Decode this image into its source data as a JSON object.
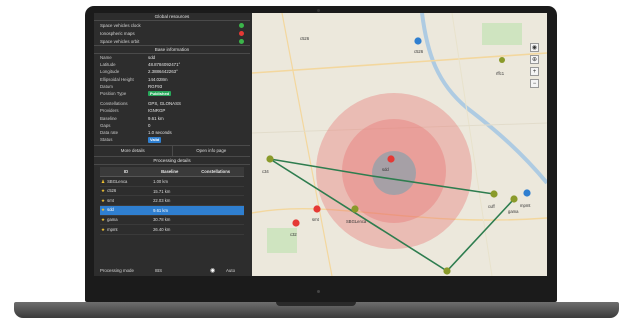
{
  "global_resources": {
    "title": "Global resources",
    "items": [
      {
        "label": "Space vehicles clock",
        "status_color": "#3bb54a"
      },
      {
        "label": "Ionospheric maps",
        "status_color": "#e53935"
      },
      {
        "label": "Space vehicles orbit",
        "status_color": "#3bb54a"
      }
    ]
  },
  "base_information": {
    "title": "Base information",
    "fields": [
      {
        "key": "Name",
        "value": "sdd"
      },
      {
        "key": "Latitude",
        "value": "48.8784092471°"
      },
      {
        "key": "Longitude",
        "value": "2.3886442263°"
      },
      {
        "key": "Ellipsoidal Height",
        "value": "144.028m"
      },
      {
        "key": "Datum",
        "value": "RGF93"
      }
    ],
    "position_type": {
      "key": "Position Type",
      "value": "Published",
      "color": "#27a85a"
    },
    "fields2": [
      {
        "key": "Constellations",
        "value": "GPS, GLONASS"
      },
      {
        "key": "Providers",
        "value": "IGNRGP"
      },
      {
        "key": "Baseline",
        "value": "9.61 km"
      },
      {
        "key": "Gaps",
        "value": "0"
      },
      {
        "key": "Data rate",
        "value": "1.0 seconds"
      }
    ],
    "status": {
      "key": "Status",
      "value": "Valid",
      "color": "#2f7fd0"
    }
  },
  "buttons": {
    "more_details": "More details",
    "open_info": "Open info page"
  },
  "processing": {
    "title": "Processing details",
    "headers": [
      "ID",
      "Baseline",
      "Constellations"
    ],
    "rows": [
      {
        "icon": "person",
        "id": "SBGLenca",
        "baseline": "1.00 km",
        "constellations": ""
      },
      {
        "icon": "star",
        "id": "c526",
        "baseline": "15.71 km",
        "constellations": ""
      },
      {
        "icon": "star",
        "id": "smt",
        "baseline": "22.03 km",
        "constellations": ""
      },
      {
        "icon": "star",
        "id": "sdd",
        "baseline": "9.61 km",
        "constellations": "",
        "selected": true
      },
      {
        "icon": "star",
        "id": "gama",
        "baseline": "30.78 km",
        "constellations": ""
      },
      {
        "icon": "star",
        "id": "mpmt",
        "baseline": "26.40 km",
        "constellations": ""
      }
    ],
    "footer": {
      "mode_label": "Processing mode",
      "mode_value": "IBS",
      "auto": "Auto"
    }
  },
  "map": {
    "labels": [
      "c526",
      "c526",
      "sdd",
      "smt",
      "c34",
      "SBGLenca",
      "c32",
      "cuff",
      "gama",
      "mpmt",
      "rffc1"
    ],
    "controls": [
      "◉",
      "⊕",
      "+",
      "−"
    ]
  }
}
